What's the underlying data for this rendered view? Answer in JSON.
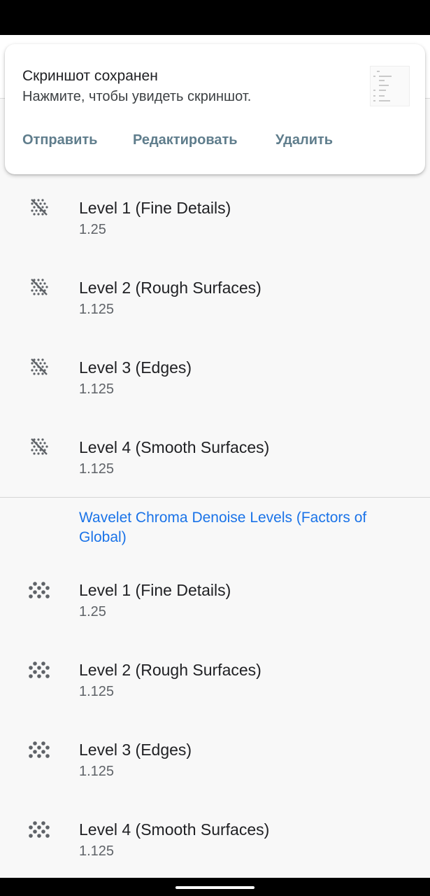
{
  "notification": {
    "title": "Скриншот сохранен",
    "text": "Нажмите, чтобы увидеть скриншот.",
    "actions": [
      "Отправить",
      "Редактировать",
      "Удалить"
    ]
  },
  "luminance_levels": [
    {
      "label": "Level 1 (Fine Details)",
      "value": "1.25"
    },
    {
      "label": "Level 2 (Rough Surfaces)",
      "value": "1.125"
    },
    {
      "label": "Level 3 (Edges)",
      "value": "1.125"
    },
    {
      "label": "Level 4 (Smooth Surfaces)",
      "value": "1.125"
    }
  ],
  "chroma_section": {
    "title": "Wavelet Chroma Denoise Levels (Factors of Global)"
  },
  "chroma_levels": [
    {
      "label": "Level 1 (Fine Details)",
      "value": "1.25"
    },
    {
      "label": "Level 2 (Rough Surfaces)",
      "value": "1.125"
    },
    {
      "label": "Level 3 (Edges)",
      "value": "1.125"
    },
    {
      "label": "Level 4 (Smooth Surfaces)",
      "value": "1.125"
    }
  ],
  "icons": {
    "luminance": "luminance-noise-icon",
    "chroma": "chroma-noise-icon"
  }
}
